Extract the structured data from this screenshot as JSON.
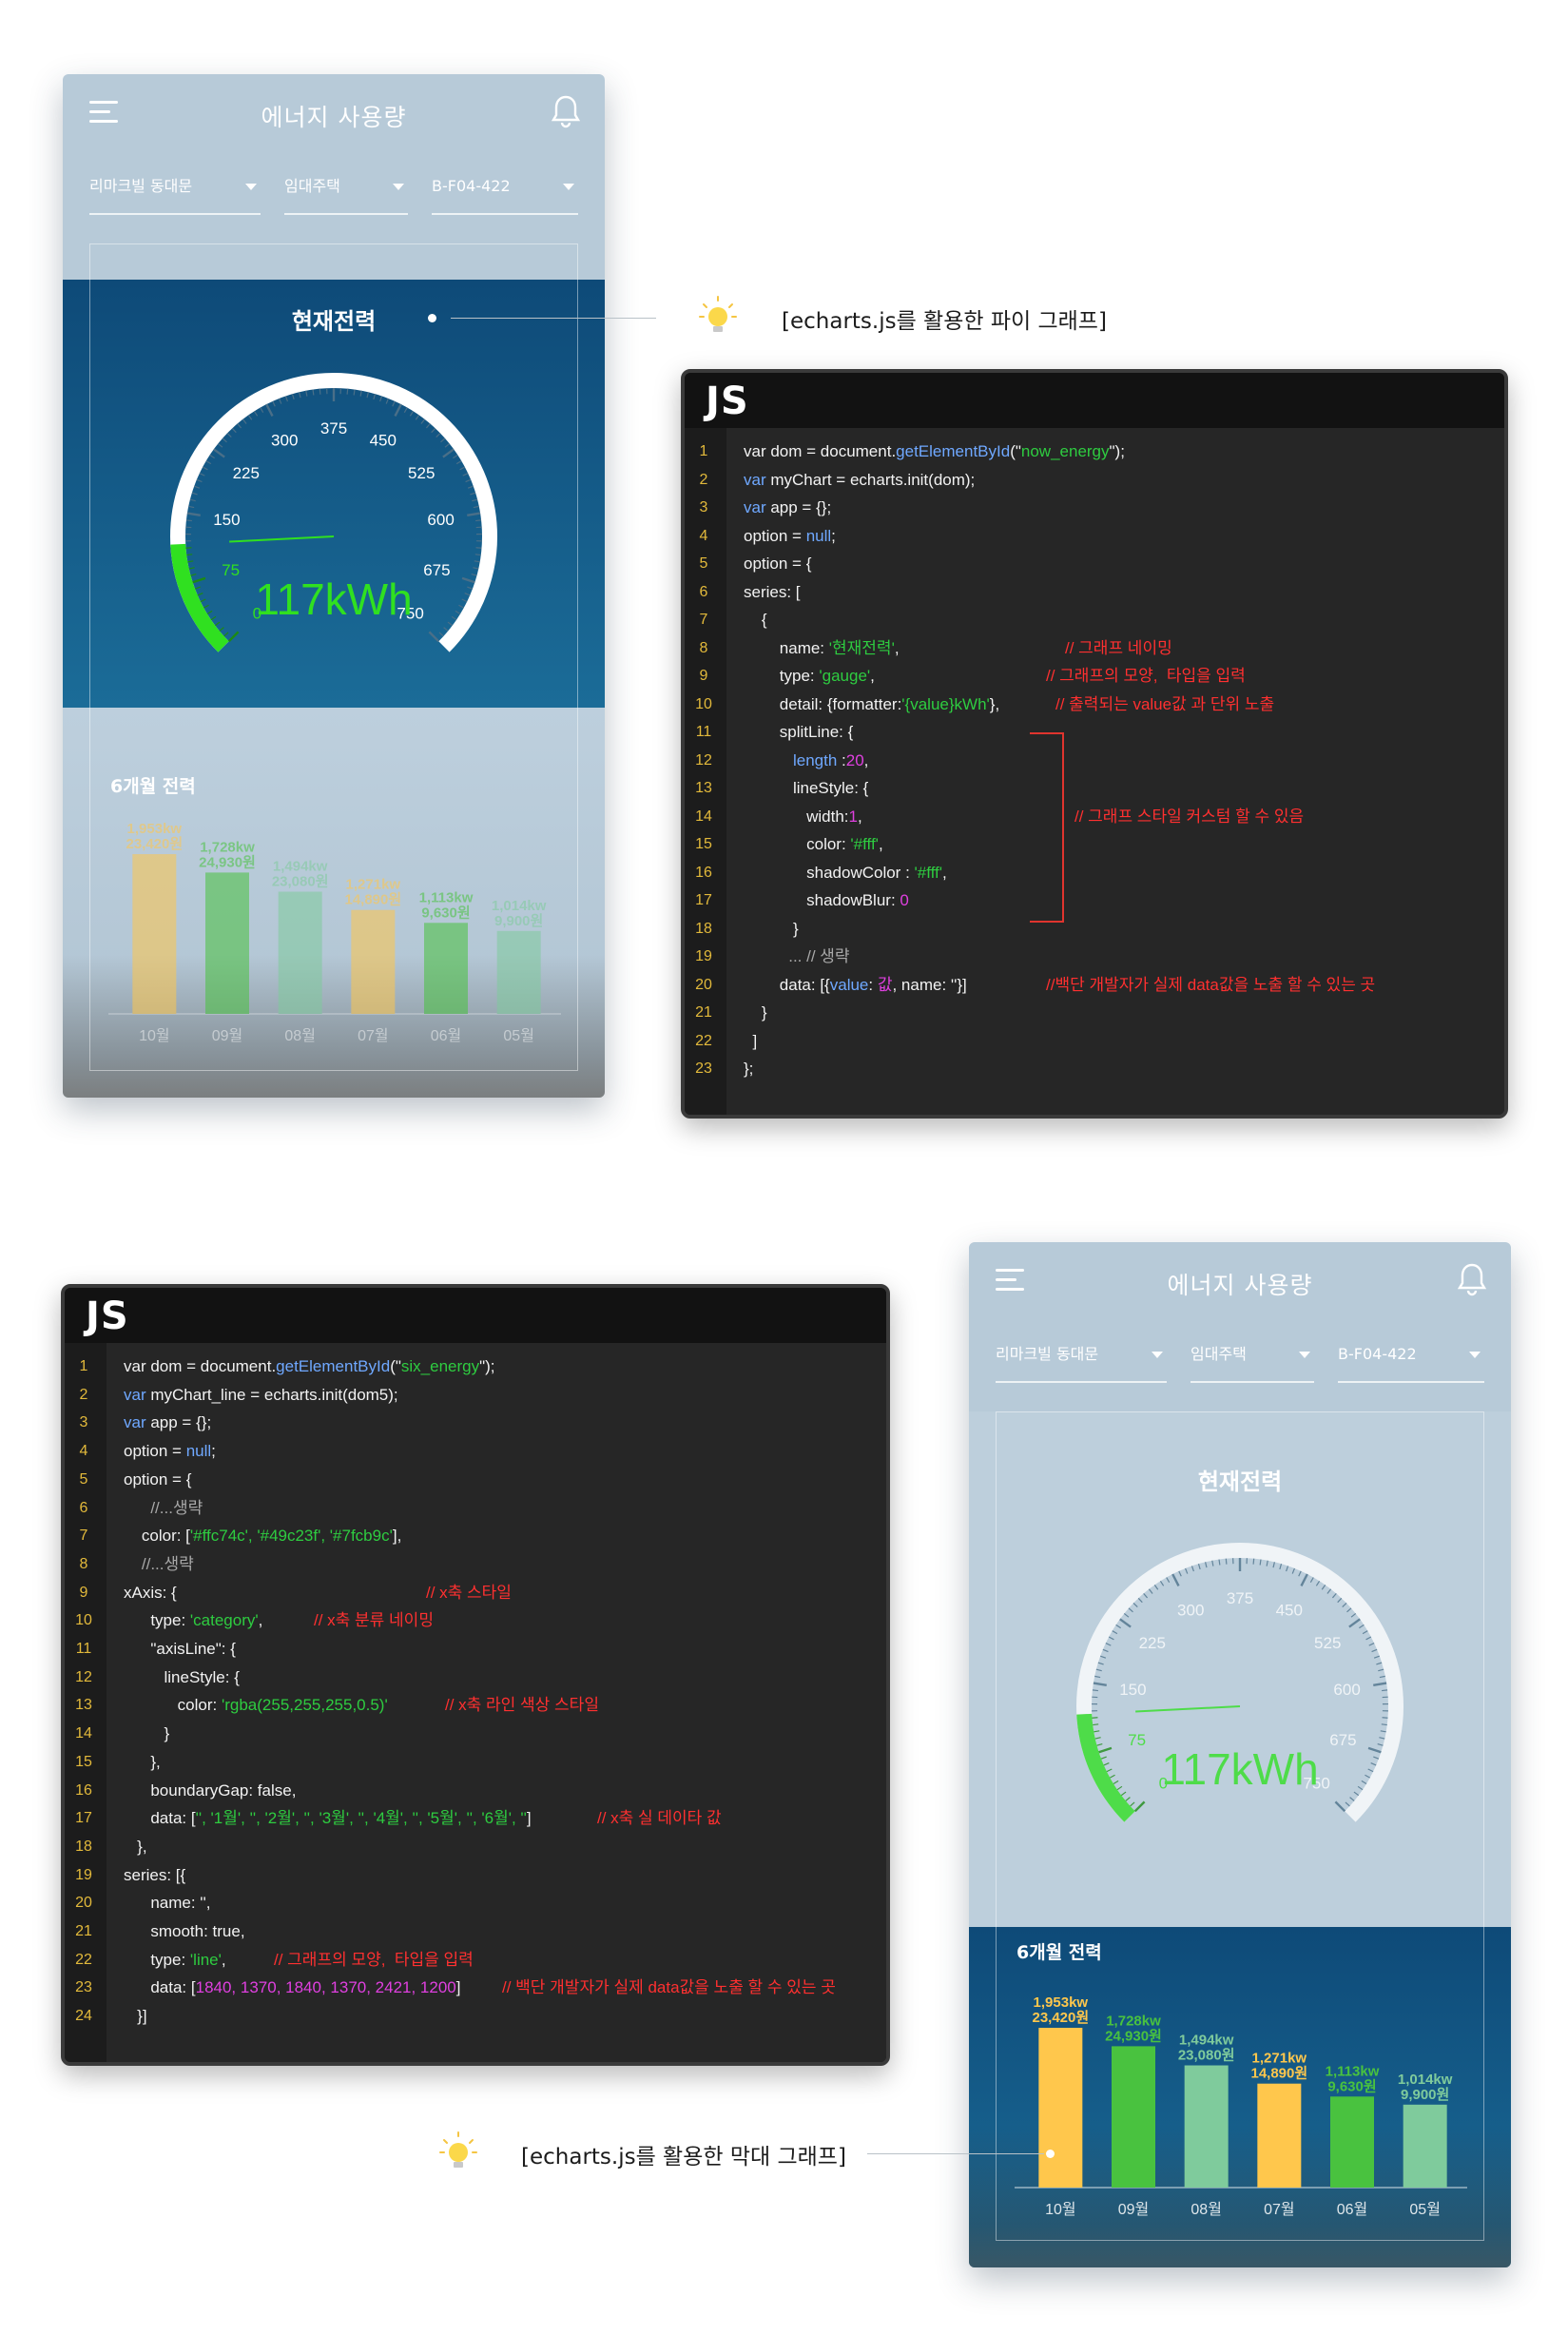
{
  "app": {
    "title": "에너지 사용량",
    "selects": [
      "리마크빌 동대문",
      "임대주택",
      "B-F04-422"
    ]
  },
  "gauge": {
    "title": "현재전력",
    "reading": "117kWh",
    "value": 117,
    "min": 0,
    "max": 750,
    "tick_labels": [
      "0",
      "75",
      "150",
      "225",
      "300",
      "375",
      "450",
      "525",
      "600",
      "675",
      "750"
    ],
    "accent": "#30e020"
  },
  "bars": {
    "title": "6개월 전력",
    "colors": [
      "#ffc74c",
      "#49c23f",
      "#7fcb9c"
    ]
  },
  "chart_data": {
    "type": "bar",
    "title": "6개월 전력",
    "categories": [
      "10월",
      "09월",
      "08월",
      "07월",
      "06월",
      "05월"
    ],
    "values_kw": [
      1953,
      1728,
      1494,
      1271,
      1113,
      1014
    ],
    "kw_labels": [
      "1,953kw",
      "1,728kw",
      "1,494kw",
      "1,271kw",
      "1,113kw",
      "1,014kw"
    ],
    "won_labels": [
      "23,420원",
      "24,930원",
      "23,080원",
      "14,890원",
      "9,630원",
      "9,900원"
    ]
  },
  "annotations": {
    "pie": "[echarts.js를 활용한 파이 그래프]",
    "bar": "[echarts.js를 활용한 막대 그래프]"
  },
  "code_a": {
    "header": "JS",
    "lines": [
      [
        [
          "w",
          "var dom = document."
        ],
        [
          "b",
          "getElementById"
        ],
        [
          "w",
          "(\""
        ],
        [
          "g",
          "now_energy"
        ],
        [
          "w",
          "\");"
        ]
      ],
      [
        [
          "b",
          "var"
        ],
        [
          "w",
          " myChart = echarts.init(dom);"
        ]
      ],
      [
        [
          "b",
          "var"
        ],
        [
          "w",
          " app = {};"
        ]
      ],
      [
        [
          "w",
          "option = "
        ],
        [
          "b",
          "null"
        ],
        [
          "w",
          ";"
        ]
      ],
      [
        [
          "w",
          "option = {"
        ]
      ],
      [
        [
          "w",
          "series: ["
        ]
      ],
      [
        [
          "w",
          "    {"
        ]
      ],
      [
        [
          "w",
          "        name: "
        ],
        [
          "g",
          "'현재전력'"
        ],
        [
          "w",
          ","
        ]
      ],
      [
        [
          "w",
          "        type: "
        ],
        [
          "g",
          "'gauge'"
        ],
        [
          "w",
          ","
        ]
      ],
      [
        [
          "w",
          "        detail: {formatter:"
        ],
        [
          "g",
          "'{value}kWh'"
        ],
        [
          "w",
          "},"
        ]
      ],
      [
        [
          "w",
          "        splitLine: {"
        ]
      ],
      [
        [
          "w",
          "           "
        ],
        [
          "b",
          "length"
        ],
        [
          "w",
          " :"
        ],
        [
          "m",
          "20"
        ],
        [
          "w",
          ","
        ]
      ],
      [
        [
          "w",
          "           lineStyle: {"
        ]
      ],
      [
        [
          "w",
          "              width:"
        ],
        [
          "m",
          "1"
        ],
        [
          "w",
          ","
        ]
      ],
      [
        [
          "w",
          "              color: "
        ],
        [
          "g",
          "'#fff'"
        ],
        [
          "w",
          ","
        ]
      ],
      [
        [
          "w",
          "              shadowColor : "
        ],
        [
          "g",
          "'#fff'"
        ],
        [
          "w",
          ","
        ]
      ],
      [
        [
          "w",
          "              shadowBlur: "
        ],
        [
          "m",
          "0"
        ]
      ],
      [
        [
          "w",
          "           }"
        ]
      ],
      [
        [
          "gy",
          "          ... // 생략"
        ]
      ],
      [
        [
          "w",
          "        data: [{"
        ],
        [
          "b",
          "value"
        ],
        [
          "w",
          ": "
        ],
        [
          "m",
          "값"
        ],
        [
          "w",
          ", name: ''}]"
        ]
      ],
      [
        [
          "w",
          "    }"
        ]
      ],
      [
        [
          "w",
          "  ]"
        ]
      ],
      [
        [
          "w",
          "};"
        ]
      ]
    ],
    "comments": [
      {
        "line": 8,
        "text": "// 그래프 네이밍"
      },
      {
        "line": 9,
        "text": "// 그래프의 모양,  타입을 입력"
      },
      {
        "line": 10,
        "text": "// 출력되는 value값 과 단위 노출"
      },
      {
        "line": 14,
        "text": "// 그래프 스타일 커스텀 할 수 있음"
      },
      {
        "line": 20,
        "text": "//백단 개발자가 실제 data값을 노출 할 수 있는 곳"
      }
    ]
  },
  "code_b": {
    "header": "JS",
    "lines": [
      [
        [
          "w",
          "var dom = document."
        ],
        [
          "b",
          "getElementById"
        ],
        [
          "w",
          "(\""
        ],
        [
          "g",
          "six_energy"
        ],
        [
          "w",
          "\");"
        ]
      ],
      [
        [
          "b",
          "var"
        ],
        [
          "w",
          " myChart_line = echarts.init(dom5);"
        ]
      ],
      [
        [
          "b",
          "var"
        ],
        [
          "w",
          " app = {};"
        ]
      ],
      [
        [
          "w",
          "option = "
        ],
        [
          "b",
          "null"
        ],
        [
          "w",
          ";"
        ]
      ],
      [
        [
          "w",
          "option = {"
        ]
      ],
      [
        [
          "gy",
          "      //...생략"
        ]
      ],
      [
        [
          "w",
          "    color: ["
        ],
        [
          "g",
          "'#ffc74c', '#49c23f', '#7fcb9c'"
        ],
        [
          "w",
          "],"
        ]
      ],
      [
        [
          "gy",
          "    //...생략"
        ]
      ],
      [
        [
          "w",
          "xAxis: {"
        ]
      ],
      [
        [
          "w",
          "      type: "
        ],
        [
          "g",
          "'category'"
        ],
        [
          "w",
          ","
        ]
      ],
      [
        [
          "w",
          "      \"axisLine\": {"
        ]
      ],
      [
        [
          "w",
          "         lineStyle: {"
        ]
      ],
      [
        [
          "w",
          "            color: "
        ],
        [
          "g",
          "'rgba(255,255,255,0.5)'"
        ]
      ],
      [
        [
          "w",
          "         }"
        ]
      ],
      [
        [
          "w",
          "      },"
        ]
      ],
      [
        [
          "w",
          "      boundaryGap: false,"
        ]
      ],
      [
        [
          "w",
          "      data: ["
        ],
        [
          "g",
          "'', '1월', '', '2월', '', '3월', '', '4월', '', '5월', '', '6월', ''"
        ],
        [
          "w",
          "]"
        ]
      ],
      [
        [
          "w",
          "   },"
        ]
      ],
      [
        [
          "w",
          "series: [{"
        ]
      ],
      [
        [
          "w",
          "      name: '',"
        ]
      ],
      [
        [
          "w",
          "      smooth: true,"
        ]
      ],
      [
        [
          "w",
          "      type: "
        ],
        [
          "g",
          "'line'"
        ],
        [
          "w",
          ","
        ]
      ],
      [
        [
          "w",
          "      data: ["
        ],
        [
          "m",
          "1840, 1370, 1840, 1370, 2421, 1200"
        ],
        [
          "w",
          "]"
        ]
      ],
      [
        [
          "w",
          "   }]"
        ]
      ]
    ],
    "comments": [
      {
        "line": 9,
        "text": "// x축 스타일"
      },
      {
        "line": 10,
        "text": "// x축 분류 네이밍"
      },
      {
        "line": 13,
        "text": "// x축 라인 색상 스타일"
      },
      {
        "line": 17,
        "text": "// x축 실 데이타 값"
      },
      {
        "line": 22,
        "text": "// 그래프의 모양,  타입을 입력"
      },
      {
        "line": 23,
        "text": "// 백단 개발자가 실제 data값을 노출 할 수 있는 곳"
      }
    ]
  }
}
